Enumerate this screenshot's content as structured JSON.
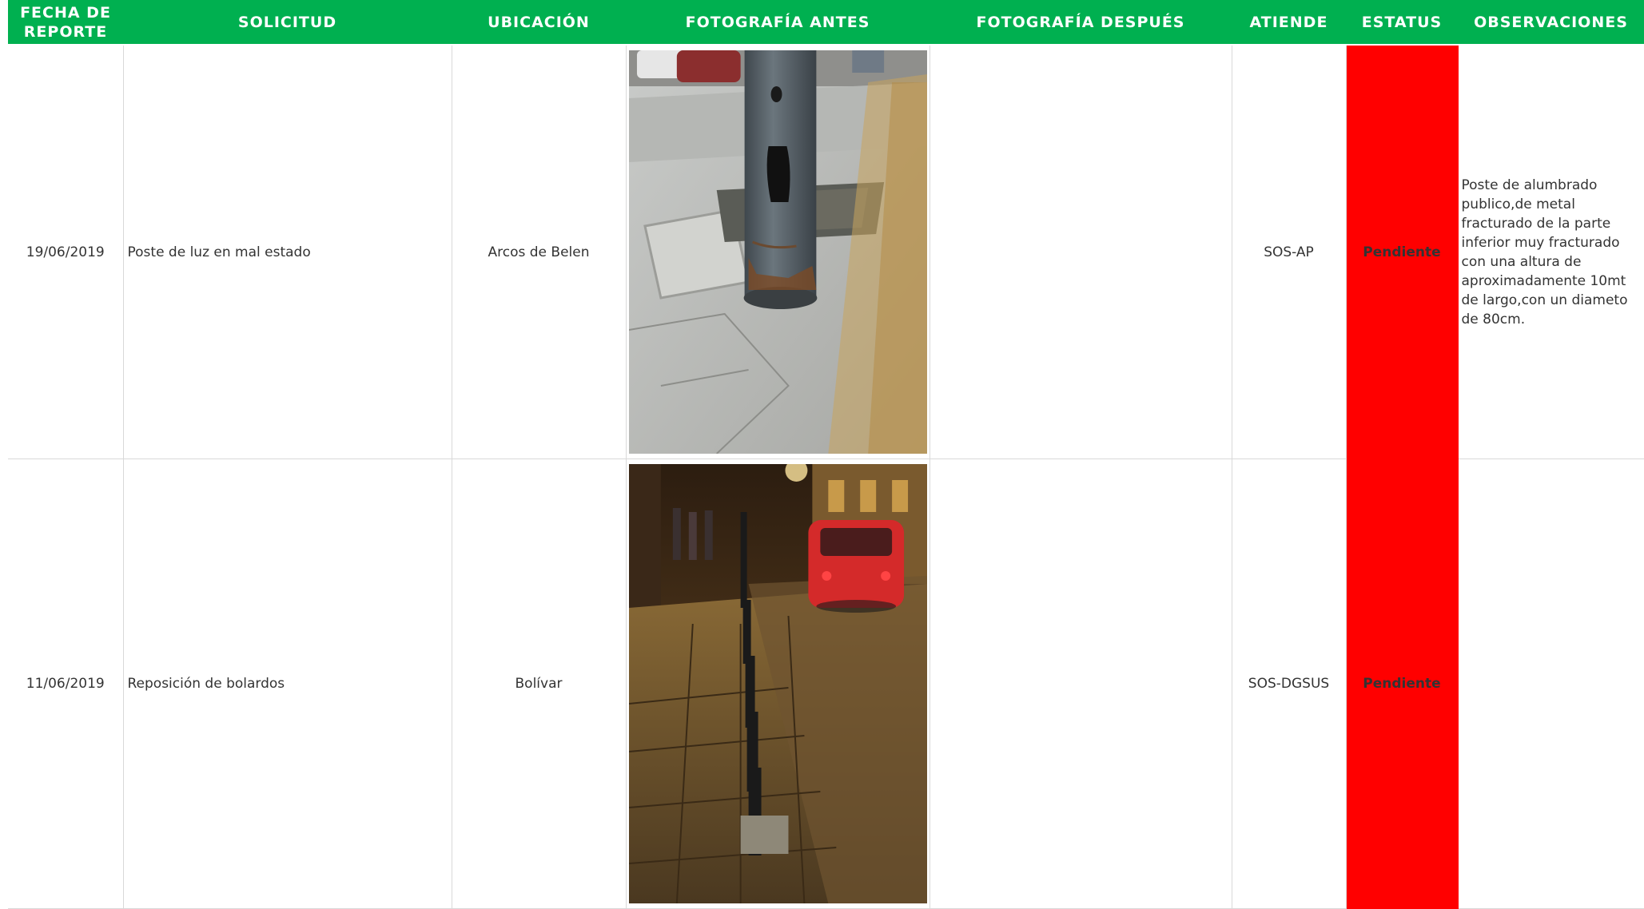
{
  "headers": {
    "fecha": "FECHA DE REPORTE",
    "solicitud": "SOLICITUD",
    "ubicacion": "UBICACIÓN",
    "foto_antes": "FOTOGRAFÍA ANTES",
    "foto_despues": "FOTOGRAFÍA DESPUÉS",
    "atiende": "ATIENDE",
    "estatus": "ESTATUS",
    "observaciones": "OBSERVACIONES"
  },
  "rows": [
    {
      "fecha": "19/06/2019",
      "solicitud": "Poste de luz en mal estado",
      "ubicacion": "Arcos de Belen",
      "foto_antes": "broken-lamp-post-photo",
      "foto_despues": "",
      "atiende": "SOS-AP",
      "estatus": "Pendiente",
      "observaciones": "Poste de alumbrado publico,de metal fracturado de la parte inferior muy fracturado con una altura de aproximadamente 10mt de largo,con un diameto de 80cm."
    },
    {
      "fecha": "11/06/2019",
      "solicitud": "Reposición de bolardos",
      "ubicacion": "Bolívar",
      "foto_antes": "street-bollards-night-photo",
      "foto_despues": "",
      "atiende": "SOS-DGSUS",
      "estatus": "Pendiente",
      "observaciones": ""
    }
  ],
  "colors": {
    "header_bg": "#00b050",
    "header_text": "#ffffff",
    "status_bg": "#ff0000",
    "grid": "#d9d9d9"
  }
}
